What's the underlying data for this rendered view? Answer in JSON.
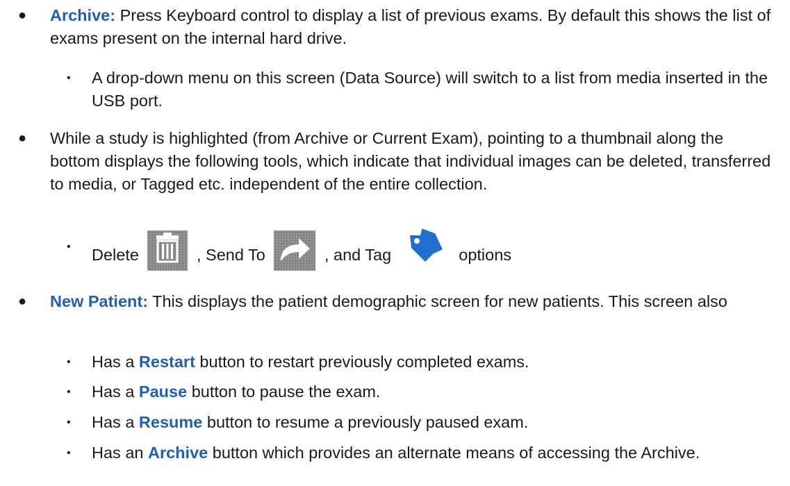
{
  "sections": {
    "archive": {
      "term": "Archive:",
      "text": " Press Keyboard control to display a list of previous exams.  By default this shows the list of exams present on the internal hard drive.",
      "sub": "A drop-down menu on this screen (Data Source) will switch to a list from media  inserted in the USB port."
    },
    "study": {
      "text": "While a study is highlighted (from Archive or Current Exam), pointing to a thumbnail along the bottom displays the following tools, which indicate that individual images can be deleted, transferred to media, or Tagged etc. independent of the entire collection.",
      "tools": {
        "delete": "Delete",
        "sep1": ", Send To",
        "sep2": ", and Tag",
        "end": "options"
      }
    },
    "new_patient": {
      "term": "New Patient:",
      "text": " This displays the patient demographic screen for new patients.  This screen also",
      "restart": {
        "pre": "Has  a ",
        "term": "Restart",
        "post": " button to restart previously completed exams."
      },
      "pause": {
        "pre": "Has  a ",
        "term": "Pause",
        "post": " button to pause the exam."
      },
      "resume": {
        "pre": "Has  a ",
        "term": "Resume",
        "post": " button to resume a previously paused exam."
      },
      "archive_btn": {
        "pre": "Has an ",
        "term": "Archive",
        "post": " button which provides an alternate means of accessing the Archive."
      }
    }
  },
  "icons": {
    "delete": "trash-icon",
    "send_to": "send-to-icon",
    "tag": "tag-icon"
  },
  "colors": {
    "accent": "#1f5fb4",
    "tag_blue": "#1e6fd0",
    "icon_gray": "#8f8f8f"
  }
}
